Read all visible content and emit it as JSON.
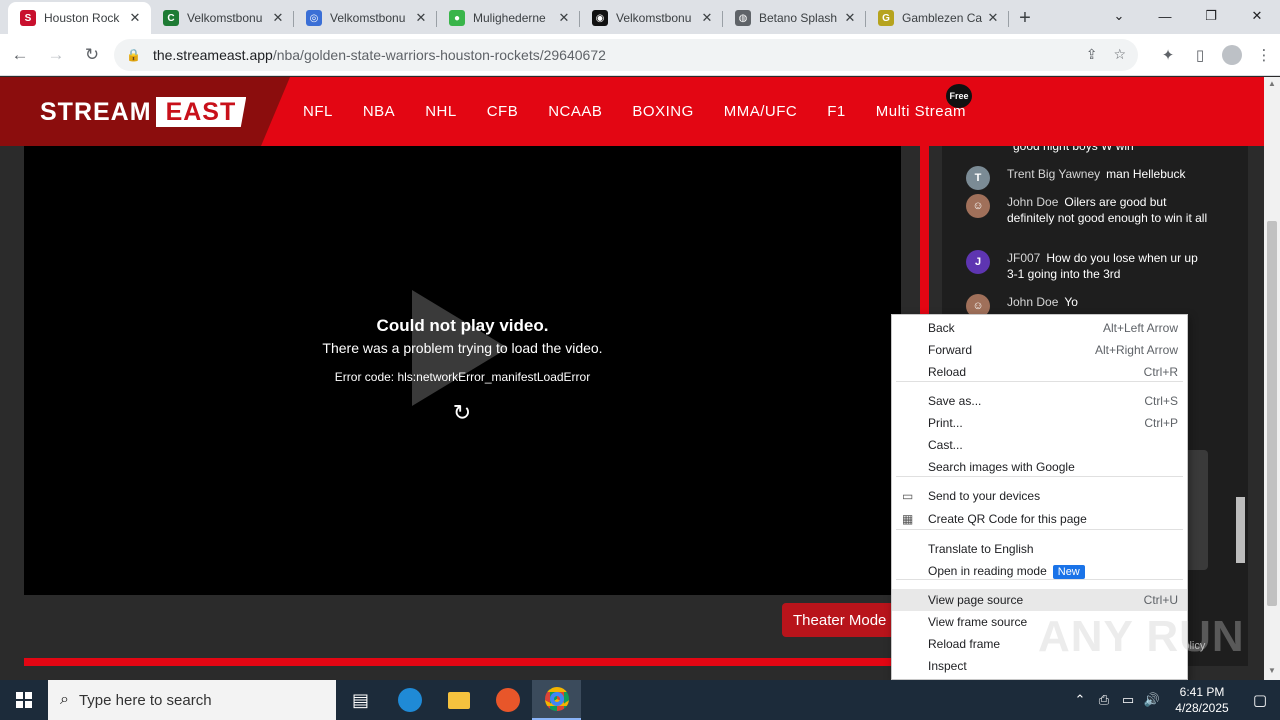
{
  "browser": {
    "tabs": [
      {
        "title": "Houston Rock",
        "color": "#c8102e",
        "glyph": "S",
        "active": true
      },
      {
        "title": "Velkomstbonu",
        "color": "#1e7b34",
        "glyph": "C",
        "active": false
      },
      {
        "title": "Velkomstbonu",
        "color": "#3b6fd6",
        "glyph": "◎",
        "active": false
      },
      {
        "title": "Mulighederne",
        "color": "#39b54a",
        "glyph": "●",
        "active": false
      },
      {
        "title": "Velkomstbonu",
        "color": "#111111",
        "glyph": "◉",
        "active": false
      },
      {
        "title": "Betano Splash",
        "color": "#5f6368",
        "glyph": "◍",
        "active": false
      },
      {
        "title": "Gamblezen Ca",
        "color": "#b6a31e",
        "glyph": "G",
        "active": false
      }
    ],
    "new_tab": "+",
    "window_controls": [
      "⌄",
      "—",
      "❐",
      "✕"
    ],
    "url_host": "the.streameast.app",
    "url_path": "/nba/golden-state-warriors-houston-rockets/29640672"
  },
  "site": {
    "logo_left": "STREAM",
    "logo_right": "EAST",
    "nav": [
      "NFL",
      "NBA",
      "NHL",
      "CFB",
      "NCAAB",
      "BOXING",
      "MMA/UFC",
      "F1",
      "Multi Stream"
    ],
    "free_badge": "Free"
  },
  "video": {
    "error_title": "Could not play video.",
    "error_message": "There was a problem trying to load the video.",
    "error_code": "Error code: hls:networkError_manifestLoadError"
  },
  "theater_button": "Theater Mode",
  "chat": {
    "messages": [
      {
        "name": "",
        "text": "good night boys W win",
        "avatar": "",
        "avatar_color": "transparent"
      },
      {
        "name": "Trent Big Yawney",
        "text": "man Hellebuck",
        "avatar": "T",
        "avatar_color": "#7b8b95"
      },
      {
        "name": "John Doe",
        "text": "Oilers are good but definitely not good enough to win it all",
        "avatar": "☺",
        "avatar_color": "#a0705a"
      },
      {
        "name": "JF007",
        "text": "How do you lose when ur up 3-1 going into the 3rd",
        "avatar": "J",
        "avatar_color": "#5e35b1"
      },
      {
        "name": "John Doe",
        "text": "Yo",
        "avatar": "☺",
        "avatar_color": "#a0705a"
      }
    ],
    "privacy": "Policy"
  },
  "context_menu": [
    {
      "label": "Back",
      "shortcut": "Alt+Left Arrow"
    },
    {
      "label": "Forward",
      "shortcut": "Alt+Right Arrow"
    },
    {
      "label": "Reload",
      "shortcut": "Ctrl+R"
    },
    {
      "label": "Save as...",
      "shortcut": "Ctrl+S"
    },
    {
      "label": "Print...",
      "shortcut": "Ctrl+P"
    },
    {
      "label": "Cast...",
      "shortcut": ""
    },
    {
      "label": "Search images with Google",
      "shortcut": ""
    },
    {
      "label": "Send to your devices",
      "shortcut": ""
    },
    {
      "label": "Create QR Code for this page",
      "shortcut": ""
    },
    {
      "label": "Translate to English",
      "shortcut": ""
    },
    {
      "label": "Open in reading mode",
      "shortcut": "",
      "badge": "New"
    },
    {
      "label": "View page source",
      "shortcut": "Ctrl+U"
    },
    {
      "label": "View frame source",
      "shortcut": ""
    },
    {
      "label": "Reload frame",
      "shortcut": ""
    },
    {
      "label": "Inspect",
      "shortcut": ""
    }
  ],
  "watermark": "ANY RUN",
  "taskbar": {
    "search_placeholder": "Type here to search",
    "time": "6:41 PM",
    "date": "4/28/2025"
  }
}
